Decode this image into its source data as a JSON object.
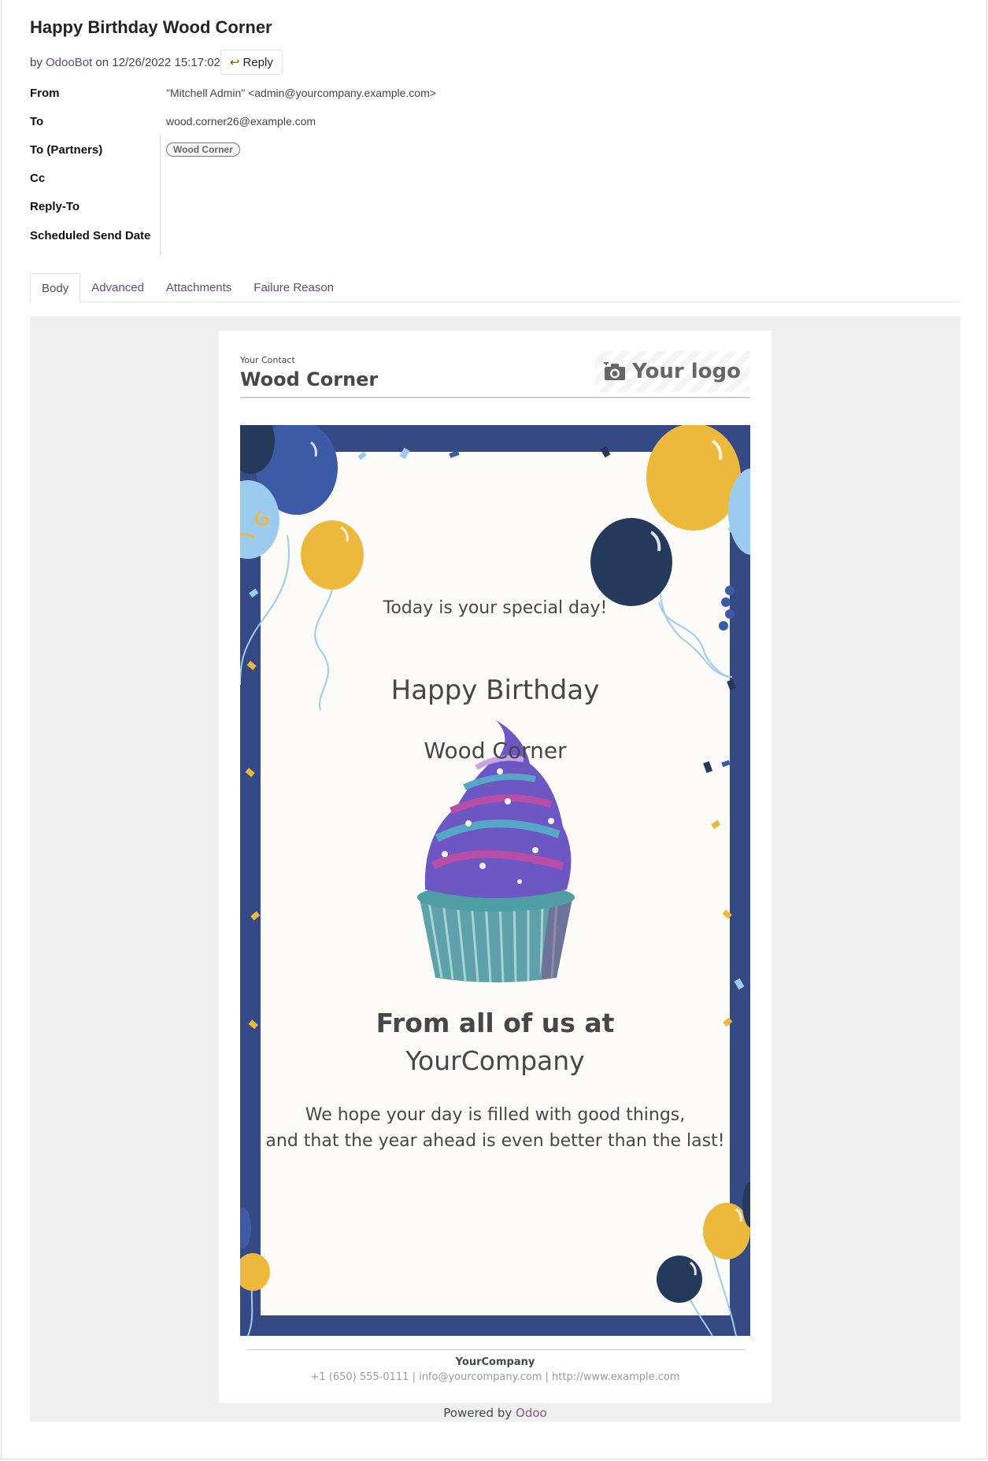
{
  "mail": {
    "subject": "Happy Birthday Wood Corner",
    "by_prefix": "by",
    "author": "OdooBot",
    "on_text": "on 12/26/2022 15:17:02",
    "reply_label": "Reply"
  },
  "fields": {
    "from_label": "From",
    "from_value": "\"Mitchell Admin\" <admin@yourcompany.example.com>",
    "to_label": "To",
    "to_value": "wood.corner26@example.com",
    "partners_label": "To (Partners)",
    "partner_tag": "Wood Corner",
    "cc_label": "Cc",
    "reply_to_label": "Reply-To",
    "scheduled_label": "Scheduled Send Date"
  },
  "tabs": [
    {
      "label": "Body",
      "active": true
    },
    {
      "label": "Advanced",
      "active": false
    },
    {
      "label": "Attachments",
      "active": false
    },
    {
      "label": "Failure Reason",
      "active": false
    }
  ],
  "email": {
    "contact_label": "Your Contact",
    "contact_name": "Wood Corner",
    "logo_text": "Your logo",
    "special_day": "Today is your special day!",
    "happy_birthday": "Happy Birthday",
    "recipient": "Wood Corner",
    "from_all": "From all of us at",
    "company": "YourCompany",
    "wish_line1": "We hope your day is filled with good things,",
    "wish_line2": "and that the year ahead is even better than the last!",
    "footer_company": "YourCompany",
    "footer_contact": "+1 (650) 555-0111 | info@yourcompany.com | http://www.example.com"
  },
  "powered": {
    "prefix": "Powered by",
    "brand": "Odoo"
  },
  "colors": {
    "card_border": "#354a84",
    "balloon_yellow": "#ecb93c",
    "balloon_navy": "#253a5b",
    "balloon_blue": "#3d5aa6",
    "balloon_light": "#9ccbf0",
    "link_purple": "#5e4b7f"
  }
}
